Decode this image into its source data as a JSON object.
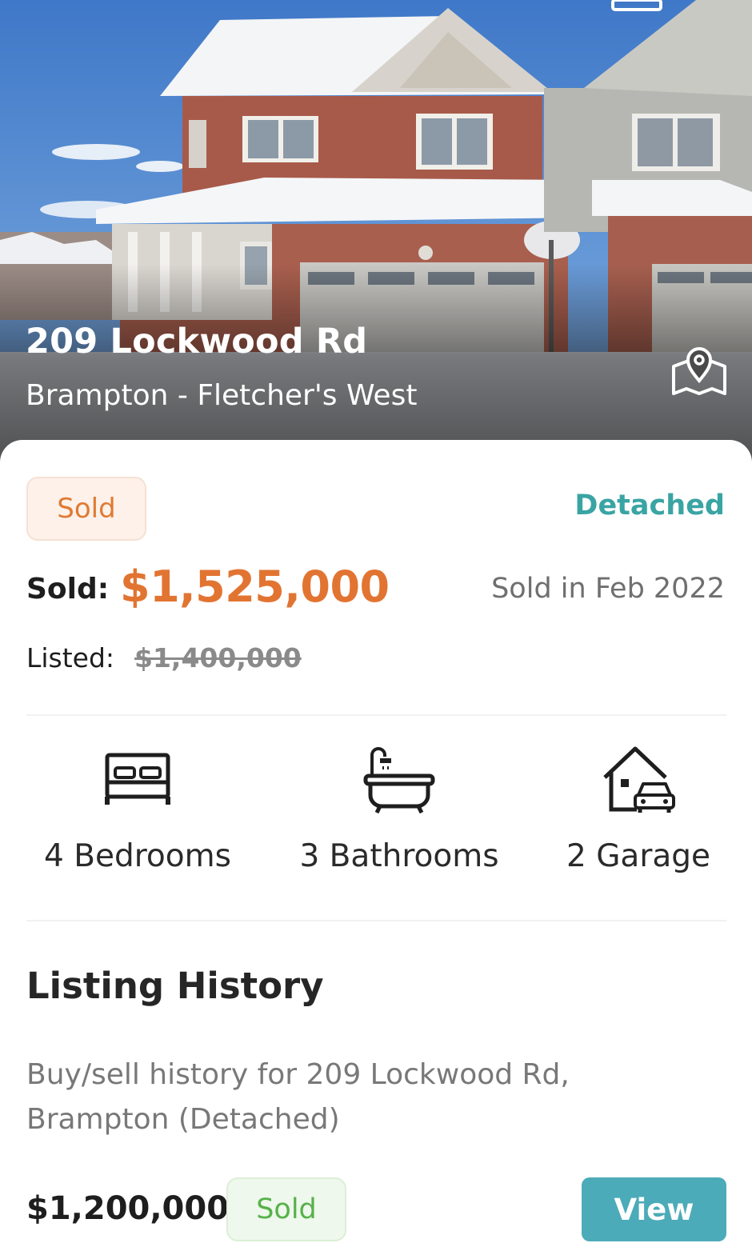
{
  "listing": {
    "address": "209 Lockwood Rd",
    "neighbourhood": "Brampton - Fletcher's West",
    "status_badge": "Sold",
    "property_type": "Detached",
    "sold_label": "Sold:",
    "sold_price": "$1,525,000",
    "sold_date": "Sold in Feb 2022",
    "listed_label": "Listed:",
    "listed_price": "$1,400,000"
  },
  "features": [
    {
      "label": "4 Bedrooms",
      "icon": "bed-icon"
    },
    {
      "label": "3 Bathrooms",
      "icon": "bathtub-icon"
    },
    {
      "label": "2 Garage",
      "icon": "garage-icon"
    }
  ],
  "history": {
    "title": "Listing History",
    "description": "Buy/sell history for 209 Lockwood Rd, Brampton (Detached)",
    "entries": [
      {
        "price": "$1,200,000",
        "status": "Sold",
        "action": "View"
      }
    ]
  },
  "icons": {
    "map": "map-pin-icon",
    "gallery": "gallery-icon"
  },
  "colors": {
    "sold_accent": "#e27432",
    "detached_teal": "#3aa4a4",
    "history_sold_green": "#57b14a",
    "view_button": "#4cabb8"
  }
}
